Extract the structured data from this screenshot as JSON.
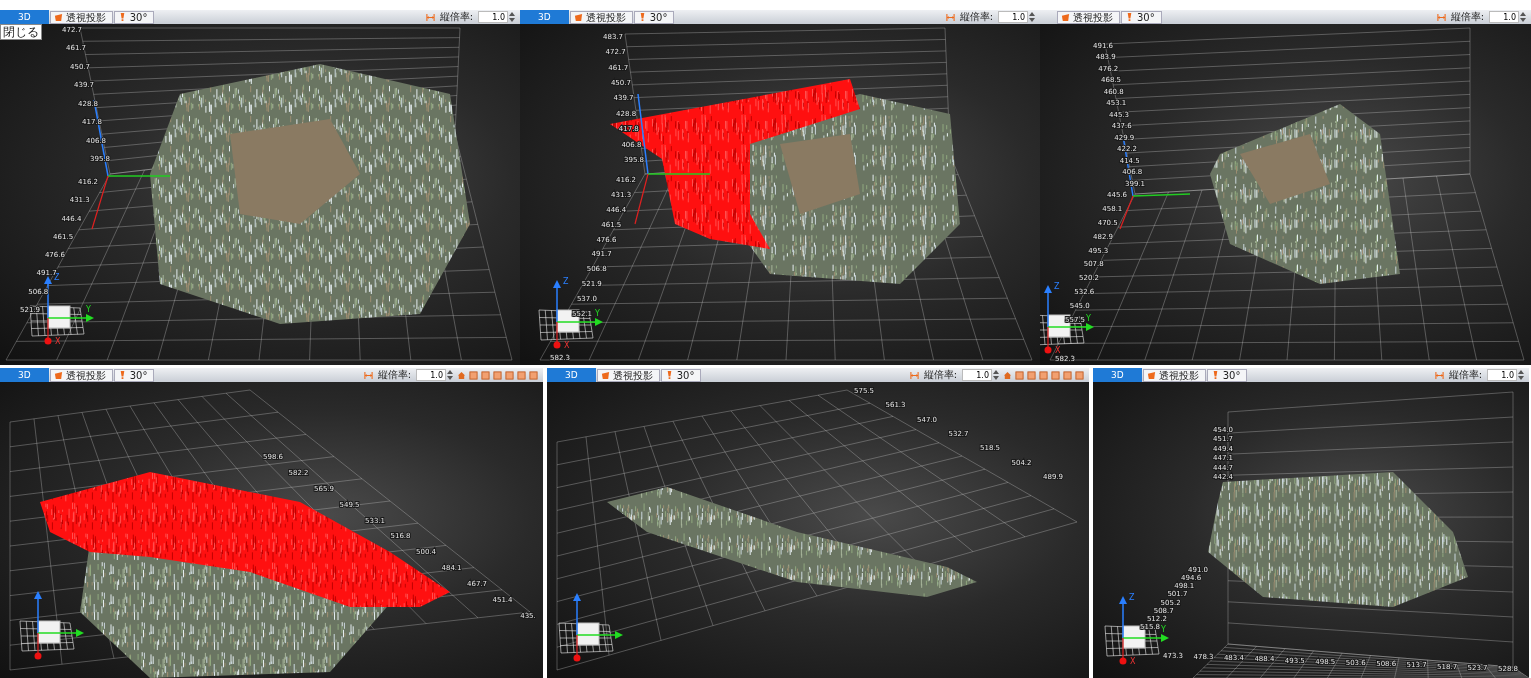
{
  "views": [
    {
      "toolbar": {
        "tabs": [
          {
            "label": "3D",
            "selected": true
          }
        ],
        "buttons": [
          {
            "kind": "projection",
            "label": "透視投影"
          },
          {
            "kind": "angle",
            "label": "30°"
          }
        ],
        "scale": {
          "label": "縦倍率:",
          "value": "1.0"
        },
        "extra_tools": false
      },
      "tooltip": "閉じる",
      "selection_shown": false,
      "scale_labels": [
        [
          "472.7",
          "461.7",
          "450.7",
          "439.7",
          "428.8",
          "417.8",
          "406.8",
          "395.8"
        ],
        [
          "416.2",
          "431.3",
          "446.4",
          "461.5",
          "476.6",
          "491.7",
          "506.8",
          "521.9"
        ]
      ],
      "gizmo_letters": [
        "Z",
        "Y",
        "X"
      ]
    },
    {
      "toolbar": {
        "tabs": [
          {
            "label": "3D",
            "selected": true
          }
        ],
        "buttons": [
          {
            "kind": "projection",
            "label": "透視投影"
          },
          {
            "kind": "angle",
            "label": "30°"
          }
        ],
        "scale": {
          "label": "縦倍率:",
          "value": "1.0"
        },
        "extra_tools": false
      },
      "selection_shown": true,
      "scale_labels": [
        [
          "483.7",
          "472.7",
          "461.7",
          "450.7",
          "439.7",
          "428.8",
          "417.8",
          "406.8",
          "395.8"
        ],
        [
          "416.2",
          "431.3",
          "446.4",
          "461.5",
          "476.6",
          "491.7",
          "506.8",
          "521.9",
          "537.0",
          "552.1"
        ],
        [
          "582.3"
        ]
      ],
      "gizmo_letters": [
        "Z",
        "Y",
        "X"
      ]
    },
    {
      "toolbar": {
        "buttons": [
          {
            "kind": "projection",
            "label": "透視投影"
          },
          {
            "kind": "angle",
            "label": "30°"
          }
        ],
        "scale": {
          "label": "縦倍率:",
          "value": "1.0"
        },
        "extra_tools": false
      },
      "selection_shown": false,
      "scale_labels": [
        [
          "491.6",
          "483.9",
          "476.2",
          "468.5",
          "460.8",
          "453.1",
          "445.3",
          "437.6",
          "429.9",
          "422.2",
          "414.5",
          "406.8",
          "399.1"
        ],
        [
          "445.6",
          "458.1",
          "470.5",
          "482.9",
          "495.3",
          "507.8",
          "520.2",
          "532.6",
          "545.0",
          "557.5"
        ],
        [
          "582.3"
        ]
      ],
      "gizmo_letters": [
        "Z",
        "Y",
        "X"
      ]
    },
    {
      "toolbar": {
        "tabs": [
          {
            "label": "3D",
            "selected": true
          }
        ],
        "buttons": [
          {
            "kind": "projection",
            "label": "透視投影"
          },
          {
            "kind": "angle",
            "label": "30°"
          }
        ],
        "scale": {
          "label": "縦倍率:",
          "value": "1.0"
        },
        "extra_tools": true
      },
      "selection_shown": true,
      "scale_labels": [
        [
          "598.6",
          "582.2",
          "565.9",
          "549.5",
          "533.1",
          "516.8",
          "500.4",
          "484.1",
          "467.7",
          "451.4",
          "435."
        ]
      ]
    },
    {
      "toolbar": {
        "tabs": [
          {
            "label": "3D",
            "selected": true
          }
        ],
        "buttons": [
          {
            "kind": "projection",
            "label": "透視投影"
          },
          {
            "kind": "angle",
            "label": "30°"
          }
        ],
        "scale": {
          "label": "縦倍率:",
          "value": "1.0"
        },
        "extra_tools": true
      },
      "selection_shown": false,
      "scale_labels": [
        [
          "575.5",
          "561.3",
          "547.0",
          "532.7",
          "518.5",
          "504.2",
          "489.9"
        ]
      ]
    },
    {
      "toolbar": {
        "tabs": [
          {
            "label": "3D",
            "selected": true
          }
        ],
        "buttons": [
          {
            "kind": "projection",
            "label": "透視投影"
          },
          {
            "kind": "angle",
            "label": "30°"
          }
        ],
        "scale": {
          "label": "縦倍率:",
          "value": "1.0"
        },
        "extra_tools": false
      },
      "selection_shown": false,
      "scale_labels": [
        [
          "454.0",
          "451.7",
          "449.4",
          "447.1",
          "444.7",
          "442.4"
        ],
        [
          "491.0",
          "494.6",
          "498.1",
          "501.7",
          "505.2",
          "508.7",
          "512.2",
          "515.8"
        ],
        [
          "473.3",
          "478.3",
          "483.4",
          "488.4",
          "493.5",
          "498.5",
          "503.6",
          "508.6",
          "513.7",
          "518.7",
          "523.7",
          "528.8"
        ]
      ],
      "gizmo_letters": [
        "Z",
        "Y",
        "X"
      ]
    }
  ]
}
